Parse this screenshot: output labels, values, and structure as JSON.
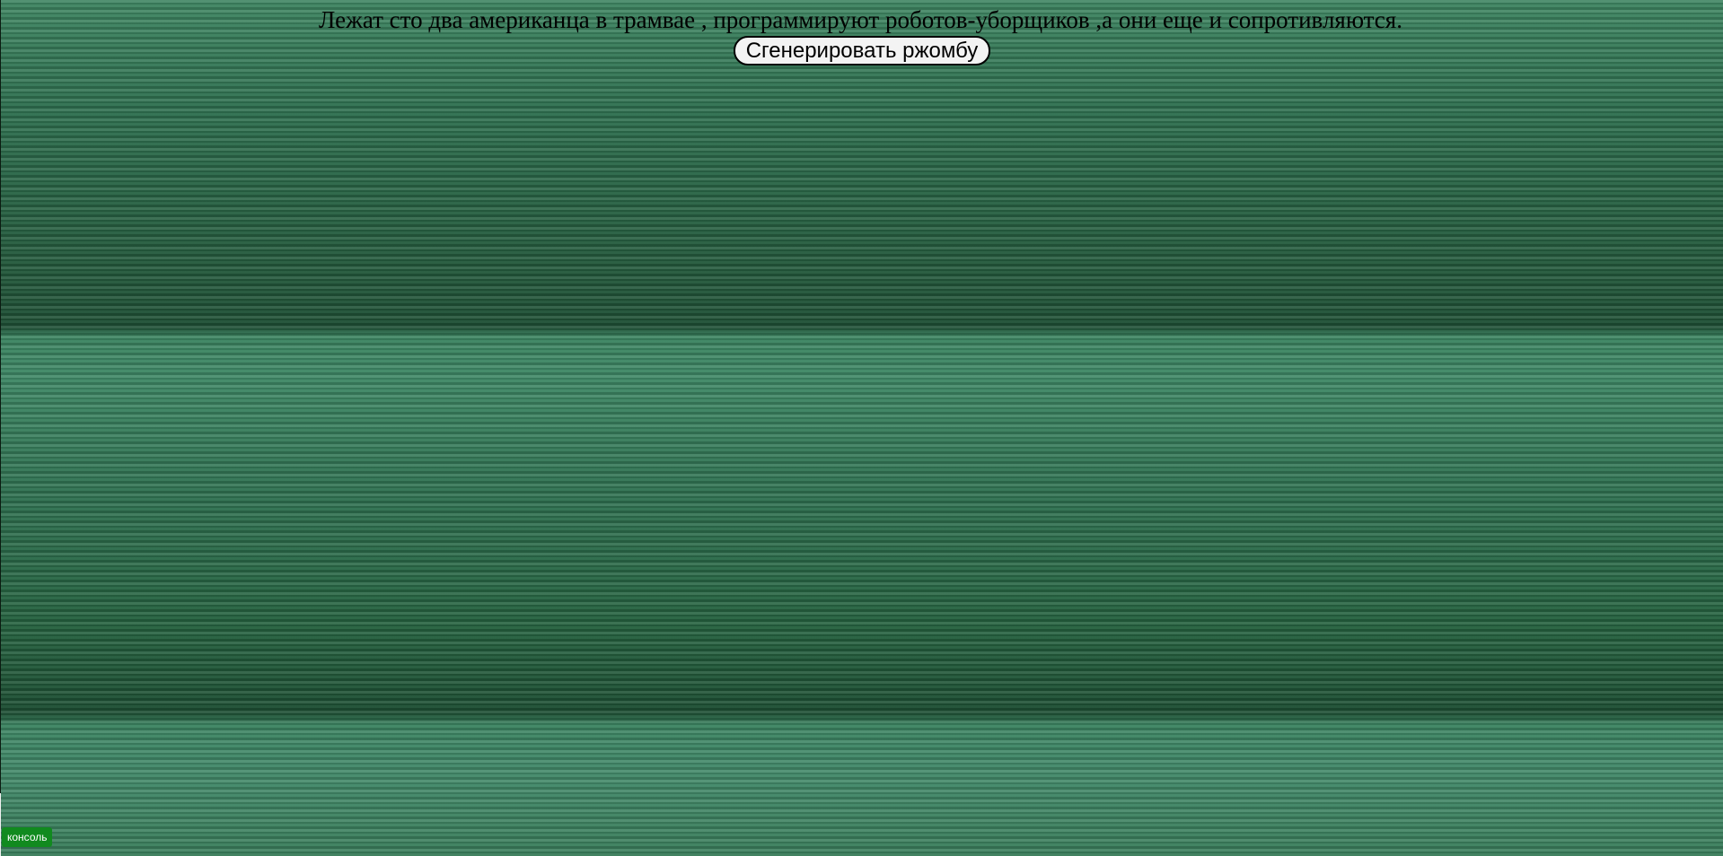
{
  "header": {
    "quote": "Лежат сто два американца в трамвае , программируют роботов-уборщиков ,а они еще и сопротивляются."
  },
  "actions": {
    "generate_label": "Сгенерировать ржомбу"
  },
  "console": {
    "label": "консоль"
  },
  "colors": {
    "background": "#2e6e4a",
    "console_button": "#118a1f",
    "generate_button": "#f3f3f3"
  }
}
